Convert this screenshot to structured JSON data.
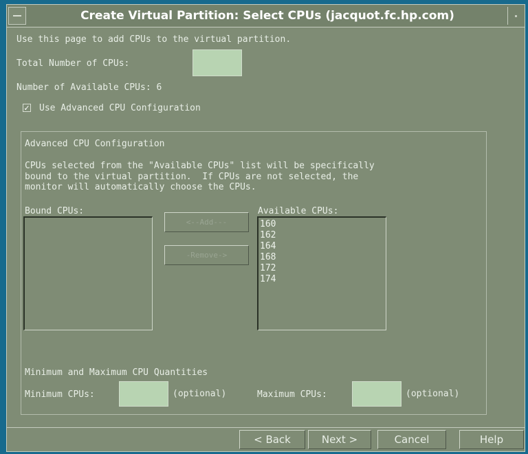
{
  "window": {
    "title": "Create Virtual Partition: Select CPUs (jacquot.fc.hp.com)"
  },
  "intro_text": "Use this page to add CPUs to the virtual partition.",
  "total_cpus": {
    "label": "Total Number of CPUs:",
    "value": ""
  },
  "available_count_text": "Number of Available CPUs: 6",
  "advanced_checkbox": {
    "label": "Use Advanced CPU Configuration",
    "checked": true,
    "mark": "✓"
  },
  "advanced": {
    "heading": "Advanced CPU Configuration",
    "description": [
      "CPUs selected from the \"Available CPUs\" list will be specifically",
      "bound to the virtual partition.  If CPUs are not selected, the",
      "monitor will automatically choose the CPUs."
    ],
    "bound_label": "Bound CPUs:",
    "bound_items": [],
    "available_label": "Available CPUs:",
    "available_items": [
      "160",
      "162",
      "164",
      "168",
      "172",
      "174"
    ],
    "add_button": "<--Add---",
    "remove_button": "-Remove->"
  },
  "quantities": {
    "heading": "Minimum and Maximum CPU Quantities",
    "min_label": "Minimum CPUs:",
    "min_value": "",
    "min_hint": "(optional)",
    "max_label": "Maximum CPUs:",
    "max_value": "",
    "max_hint": "(optional)"
  },
  "nav": {
    "back": "< Back",
    "next": "Next >",
    "cancel": "Cancel",
    "help": "Help"
  },
  "colors": {
    "desktop": "#176a8d",
    "window": "#7f8c75",
    "field": "#b8d4b2",
    "text": "#e8eee6"
  }
}
